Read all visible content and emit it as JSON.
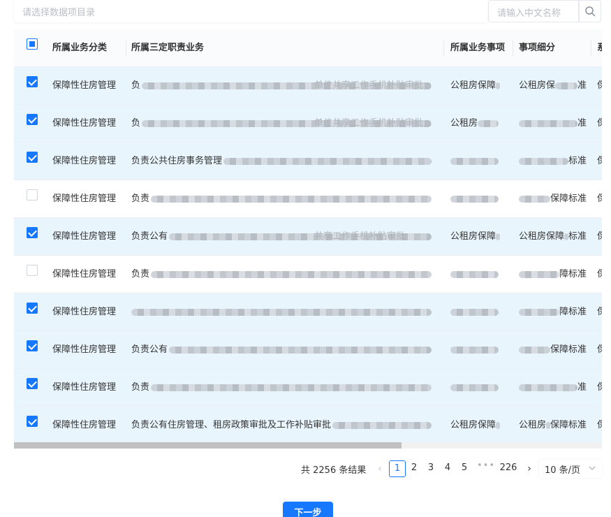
{
  "filters": {
    "directory_placeholder": "请选择数据项目录",
    "name_placeholder": "请输入中文名称",
    "search_icon": "search-icon"
  },
  "table": {
    "header": {
      "select_all_state": "partial",
      "columns": [
        "所属业务分类",
        "所属三定职责业务",
        "所属业务事项",
        "事项细分",
        "系"
      ]
    },
    "rows": [
      {
        "checked": true,
        "category": "保障性住房管理",
        "duty": "负",
        "duty_tail": "单位共享工作手机补贴审批",
        "matter": "公租房保障",
        "sub": "公租房保",
        "sub_tail": "准",
        "last": "保"
      },
      {
        "checked": true,
        "category": "保障性住房管理",
        "duty": "负",
        "duty_tail": "单位共享工作手机补贴审批",
        "matter": "公租房",
        "sub": "",
        "sub_tail": "准",
        "last": "保"
      },
      {
        "checked": true,
        "category": "保障性住房管理",
        "duty": "负责公共住房事务管理",
        "duty_tail": "",
        "matter": "",
        "sub": "",
        "sub_tail": "标准",
        "last": "保"
      },
      {
        "checked": false,
        "category": "保障性住房管理",
        "duty": "负责",
        "duty_tail": "",
        "matter": "",
        "sub": "",
        "sub_tail": "保障标准",
        "last": "保"
      },
      {
        "checked": true,
        "category": "保障性住房管理",
        "duty": "负责公有",
        "duty_tail": "共享工作手机补贴审批",
        "matter": "公租房保障",
        "sub": "公租房保障",
        "sub_tail": "标准",
        "last": "保"
      },
      {
        "checked": false,
        "category": "保障性住房管理",
        "duty": "负责",
        "duty_tail": "",
        "matter": "",
        "sub": "",
        "sub_tail": "障标准",
        "last": "保"
      },
      {
        "checked": true,
        "category": "保障性住房管理",
        "duty": "",
        "duty_tail": "",
        "matter": "",
        "sub": "",
        "sub_tail": "障标准",
        "last": "保"
      },
      {
        "checked": true,
        "category": "保障性住房管理",
        "duty": "负责公有",
        "duty_tail": "",
        "matter": "",
        "sub": "",
        "sub_tail": "保障标准",
        "last": "保"
      },
      {
        "checked": true,
        "category": "保障性住房管理",
        "duty": "负责",
        "duty_tail": "",
        "matter": "",
        "sub": "",
        "sub_tail": "准",
        "last": "保"
      },
      {
        "checked": true,
        "category": "保障性住房管理",
        "duty": "负责公有住房管理、租房政策审批及工作补贴审批",
        "duty_tail": "",
        "matter": "公租房保障",
        "sub": "公租房",
        "sub_tail": "保障标准",
        "last": "保"
      }
    ]
  },
  "pagination": {
    "total_text": "共 2256 条结果",
    "prev": "‹",
    "next": "›",
    "pages": [
      "1",
      "2",
      "3",
      "4",
      "5"
    ],
    "current": "1",
    "ellipsis": "•••",
    "last_page": "226",
    "page_size": "10 条/页"
  },
  "actions": {
    "next_step": "下一步"
  },
  "colors": {
    "primary": "#1677ff",
    "selected_row_bg": "#e9f5fd",
    "border": "#ebeef5"
  }
}
